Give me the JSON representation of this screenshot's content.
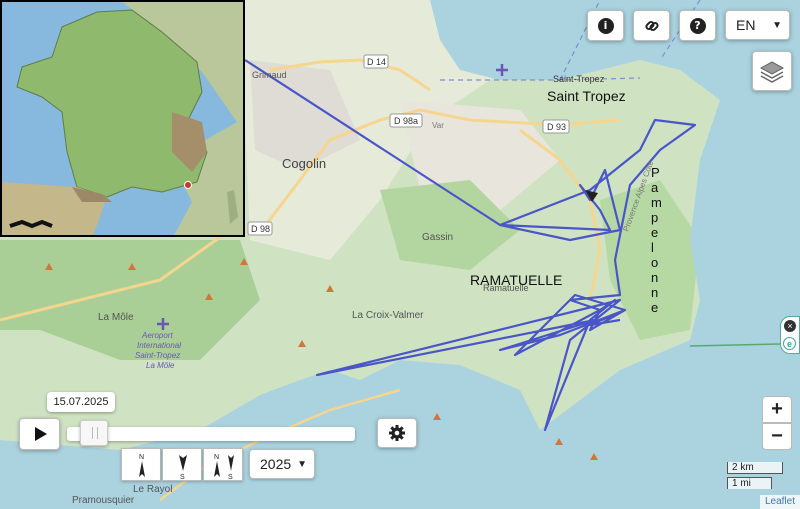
{
  "toolbar": {
    "info_icon": "info-icon",
    "link_icon": "link-icon",
    "help_icon": "help-icon",
    "language": "EN",
    "layers_icon": "layers-icon"
  },
  "map": {
    "labels": {
      "saint_tropez_small": "Saint-Tropez",
      "saint_tropez": "Saint Tropez",
      "cogolin": "Cogolin",
      "gassin": "Gassin",
      "ramatuelle_small": "Ramatuelle",
      "ramatuelle": "RAMATUELLE",
      "la_croix_valmer": "La Croix-Valmer",
      "la_mole": "La Môle",
      "le_rayol": "Le Rayol",
      "pramousquier": "Pramousquier",
      "grimaud": "Grimaud",
      "airport": "Aeroport International Saint-Tropez La Môle",
      "d14": "D 14",
      "d98a": "D 98a",
      "d93": "D 93",
      "d98": "D 98",
      "var": "Var",
      "pampelonne": "Pampelonne",
      "road_name": "Provence Alpes Côte"
    },
    "colors": {
      "track": "#4a55c8",
      "sea": "#aad3df",
      "land": "#f2efe9",
      "forest": "#add19e"
    }
  },
  "player": {
    "date": "15.07.2025",
    "progress": 0.05,
    "year": "2025"
  },
  "zoom": {
    "in": "+",
    "out": "−"
  },
  "scale": {
    "km": "2 km",
    "mi": "1 mi"
  },
  "attribution": "Leaflet"
}
